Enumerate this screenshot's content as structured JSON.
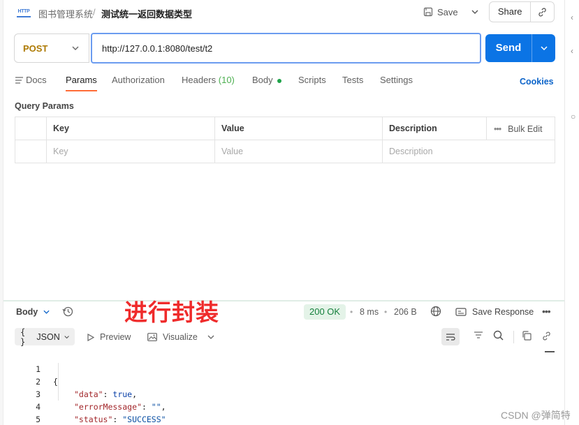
{
  "header": {
    "icon_name": "http-request-icon",
    "icon_text": "HTTP",
    "breadcrumb_parent": "图书管理系统",
    "breadcrumb_separator": "/",
    "request_title": "测试统一返回数据类型",
    "save_label": "Save",
    "share_label": "Share"
  },
  "request": {
    "method": "POST",
    "url": "http://127.0.0.1:8080/test/t2",
    "send_label": "Send"
  },
  "tabs": {
    "docs": "Docs",
    "params": "Params",
    "authorization": "Authorization",
    "headers": "Headers",
    "headers_count": "(10)",
    "body": "Body",
    "scripts": "Scripts",
    "tests": "Tests",
    "settings": "Settings",
    "active": "Params"
  },
  "cookies_label": "Cookies",
  "query_params": {
    "title": "Query Params",
    "columns": [
      "Key",
      "Value",
      "Description"
    ],
    "placeholders": [
      "Key",
      "Value",
      "Description"
    ],
    "bulk_edit": "Bulk Edit"
  },
  "annotation_text": "进行封装",
  "response": {
    "body_label": "Body",
    "status": "200 OK",
    "time": "8 ms",
    "size": "206 B",
    "save_response": "Save Response",
    "format": "JSON",
    "preview": "Preview",
    "visualize": "Visualize",
    "lines": [
      {
        "n": "1",
        "text": "{"
      },
      {
        "n": "2",
        "key": "\"data\"",
        "value": "true",
        "value_type": "bool",
        "trail": ","
      },
      {
        "n": "3",
        "key": "\"errorMessage\"",
        "value": "\"\"",
        "value_type": "string",
        "trail": ","
      },
      {
        "n": "4",
        "key": "\"status\"",
        "value": "\"SUCCESS\"",
        "value_type": "string",
        "trail": ""
      },
      {
        "n": "5",
        "text": "}"
      }
    ]
  },
  "watermark": "CSDN @弹简特",
  "colors": {
    "send": "#0b74e5",
    "method": "#ad7a03",
    "status_ok": "#15803d",
    "active_tab_underline": "#ff6c37",
    "annotation": "#ef2b2b"
  }
}
